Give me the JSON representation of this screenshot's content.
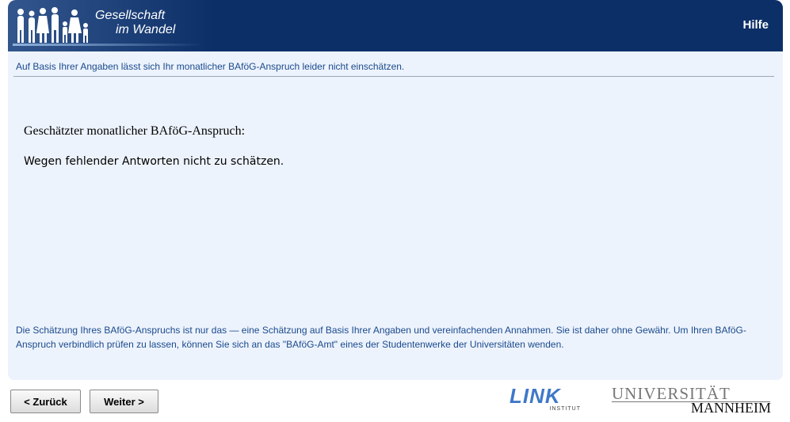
{
  "header": {
    "brand": {
      "line1": "Gesellschaft",
      "line2": "im Wandel",
      "icon": "people-silhouettes-icon"
    },
    "help_label": "Hilfe"
  },
  "main": {
    "notice": "Auf Basis Ihrer Angaben lässt sich Ihr monatlicher BAföG-Anspruch leider nicht einschätzen.",
    "estimate_label": "Geschätzter monatlicher BAföG-Anspruch:",
    "estimate_value": "Wegen fehlender Antworten nicht zu schätzen.",
    "disclaimer": "Die Schätzung Ihres BAföG-Anspruchs ist nur das — eine Schätzung auf Basis Ihrer Angaben und vereinfachenden Annahmen. Sie ist daher ohne Gewähr. Um Ihren BAföG-Anspruch verbindlich prüfen zu lassen, können Sie sich an das \"BAföG-Amt\" eines der Studentenwerke der Universitäten wenden."
  },
  "footer": {
    "back_label": "< Zurück",
    "next_label": "Weiter >",
    "link_logo": {
      "text": "LINK",
      "sub": "INSTITUT"
    },
    "uni_logo": {
      "line1": "UNIVERSITÄT",
      "line2": "MANNHEIM"
    }
  },
  "colors": {
    "header_bg": "#0d2f68",
    "panel_bg": "#edf3fd",
    "text_blue": "#1a4a8c"
  }
}
